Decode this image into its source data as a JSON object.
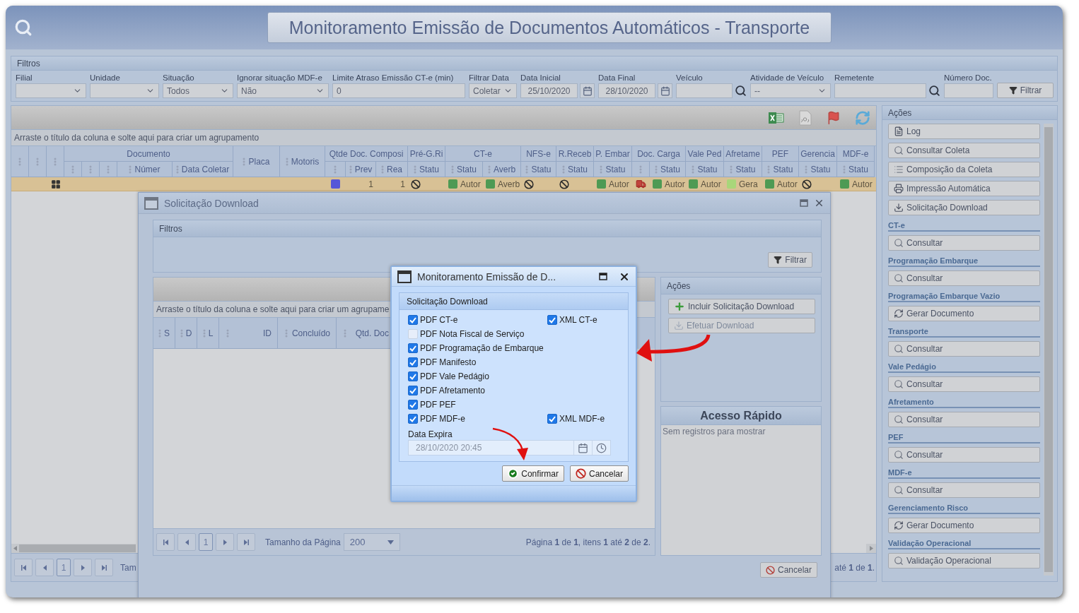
{
  "header": {
    "title": "Monitoramento Emissão de Documentos Automáticos - Transporte"
  },
  "filters": {
    "title": "Filtros",
    "fields": [
      {
        "label": "Filial",
        "kind": "select"
      },
      {
        "label": "Unidade",
        "kind": "select"
      },
      {
        "label": "Situação",
        "kind": "select",
        "value": "Todos"
      },
      {
        "label": "Ignorar situação MDF-e",
        "kind": "select",
        "value": "Não"
      },
      {
        "label": "Limite Atraso Emissão CT-e (min)",
        "kind": "text",
        "value": "0"
      },
      {
        "label": "Filtrar Data",
        "kind": "select",
        "value": "Coletar"
      },
      {
        "label": "Data Inicial",
        "kind": "date",
        "value": "25/10/2020"
      },
      {
        "label": "Data Final",
        "kind": "date",
        "value": "28/10/2020"
      },
      {
        "label": "Veículo",
        "kind": "lookup"
      },
      {
        "label": "Atividade de Veículo",
        "kind": "select",
        "value": "--"
      },
      {
        "label": "Remetente",
        "kind": "lookup"
      },
      {
        "label": "Número Doc.",
        "kind": "text"
      }
    ],
    "button": "Filtrar"
  },
  "grid": {
    "group_hint": "Arraste o título da coluna e solte aqui para criar um agrupamento",
    "columns": [
      {
        "grip": true
      },
      {
        "grip": true
      },
      {
        "grip": true
      },
      {
        "label": "Documento",
        "subcolumns": [
          {
            "grip": true
          },
          {
            "grip": true
          },
          {
            "grip": true
          },
          {
            "grip": true,
            "label": "Númer"
          },
          {
            "grip": true,
            "label": "Data Coletar"
          }
        ]
      },
      {
        "grip": true,
        "label": "Placa"
      },
      {
        "grip": true,
        "label": "Motoris"
      },
      {
        "label": "Qtde Doc. Composi",
        "subcolumns": [
          {
            "grip": true
          },
          {
            "grip": true,
            "label": "Prev"
          },
          {
            "grip": true,
            "label": "Rea"
          }
        ]
      },
      {
        "label": "Pré-G.Ri",
        "subcolumns": [
          {
            "grip": true,
            "label": "Statu"
          }
        ]
      },
      {
        "label": "CT-e",
        "subcolumns": [
          {
            "grip": true,
            "label": "Statu"
          },
          {
            "grip": true,
            "label": "Averb"
          }
        ]
      },
      {
        "label": "NFS-e",
        "subcolumns": [
          {
            "grip": true,
            "label": "Statu"
          }
        ]
      },
      {
        "label": "R.Receb",
        "subcolumns": [
          {
            "grip": true,
            "label": "Statu"
          }
        ]
      },
      {
        "label": "P. Embar",
        "subcolumns": [
          {
            "grip": true,
            "label": "Statu"
          }
        ]
      },
      {
        "label": "Doc. Carga",
        "subcolumns": [
          {
            "grip": true
          },
          {
            "grip": true,
            "label": "Statu"
          }
        ]
      },
      {
        "label": "Vale Ped",
        "subcolumns": [
          {
            "grip": true,
            "label": "Statu"
          }
        ]
      },
      {
        "label": "Afretame",
        "subcolumns": [
          {
            "grip": true,
            "label": "Statu"
          }
        ]
      },
      {
        "label": "PEF",
        "subcolumns": [
          {
            "grip": true,
            "label": "Statu"
          }
        ]
      },
      {
        "label": "Gerencia",
        "subcolumns": [
          {
            "grip": true,
            "label": "Statu"
          }
        ]
      },
      {
        "label": "MDF-e",
        "subcolumns": [
          {
            "grip": true,
            "label": "Statu"
          }
        ]
      }
    ],
    "row": {
      "cells": [
        {
          "kind": "blank"
        },
        {
          "kind": "blank"
        },
        {
          "kind": "group-icon"
        },
        {
          "kind": "blank"
        },
        {
          "kind": "blank"
        },
        {
          "kind": "blank"
        },
        {
          "kind": "blank"
        },
        {
          "kind": "blank"
        },
        {
          "kind": "blank"
        },
        {
          "kind": "blank"
        },
        {
          "kind": "swatch",
          "color": "#5656d8"
        },
        {
          "kind": "number",
          "value": "1"
        },
        {
          "kind": "number",
          "value": "1"
        },
        {
          "kind": "blocked"
        },
        {
          "kind": "status",
          "label": "Autor",
          "color": "#4e9a54"
        },
        {
          "kind": "status",
          "label": "Averb",
          "color": "#4e9a54"
        },
        {
          "kind": "blocked"
        },
        {
          "kind": "blocked"
        },
        {
          "kind": "status",
          "label": "Autor",
          "color": "#4e9a54"
        },
        {
          "kind": "truck"
        },
        {
          "kind": "status",
          "label": "Autor",
          "color": "#4e9a54"
        },
        {
          "kind": "status",
          "label": "Autor",
          "color": "#4e9a54"
        },
        {
          "kind": "status",
          "label": "Gera",
          "color": "#a8d67a"
        },
        {
          "kind": "status",
          "label": "Autor",
          "color": "#4e9a54"
        },
        {
          "kind": "blocked"
        },
        {
          "kind": "status",
          "label": "Autor",
          "color": "#4e9a54"
        }
      ]
    },
    "pager": {
      "page": "1",
      "size_label": "Tam",
      "summary": "até **1** de **1**."
    }
  },
  "actions": {
    "title": "Ações",
    "buttons": [
      {
        "label": "Log",
        "kind": "log"
      },
      {
        "label": "Consultar Coleta",
        "kind": "search"
      },
      {
        "label": "Composição da Coleta",
        "kind": "list"
      },
      {
        "label": "Impressão Automática",
        "kind": "print"
      },
      {
        "label": "Solicitação Download",
        "kind": "download"
      }
    ],
    "sections": [
      {
        "title": "CT-e",
        "buttons": [
          {
            "label": "Consultar",
            "kind": "search"
          }
        ]
      },
      {
        "title": "Programação Embarque",
        "buttons": [
          {
            "label": "Consultar",
            "kind": "search"
          }
        ]
      },
      {
        "title": "Programação Embarque Vazio",
        "buttons": [
          {
            "label": "Gerar Documento",
            "kind": "generate"
          }
        ]
      },
      {
        "title": "Transporte",
        "buttons": [
          {
            "label": "Consultar",
            "kind": "search"
          }
        ]
      },
      {
        "title": "Vale Pedágio",
        "buttons": [
          {
            "label": "Consultar",
            "kind": "search"
          }
        ]
      },
      {
        "title": "Afretamento",
        "buttons": [
          {
            "label": "Consultar",
            "kind": "search"
          }
        ]
      },
      {
        "title": "PEF",
        "buttons": [
          {
            "label": "Consultar",
            "kind": "search"
          }
        ]
      },
      {
        "title": "MDF-e",
        "buttons": [
          {
            "label": "Consultar",
            "kind": "search"
          }
        ]
      },
      {
        "title": "Gerenciamento Risco",
        "buttons": [
          {
            "label": "Gerar Documento",
            "kind": "generate"
          }
        ]
      },
      {
        "title": "Validação Operacional",
        "buttons": [
          {
            "label": "Validação Operacional",
            "kind": "search"
          }
        ]
      }
    ]
  },
  "download_window": {
    "title": "Solicitação Download",
    "filters": {
      "title": "Filtros",
      "button": "Filtrar"
    },
    "grid": {
      "group_hint": "Arraste o título da coluna e solte aqui para criar um agrupame",
      "columns": [
        {
          "grip": true,
          "label": "S"
        },
        {
          "grip": true,
          "label": "D"
        },
        {
          "grip": true,
          "label": "L"
        },
        {
          "grip": true,
          "label": "ID"
        },
        {
          "grip": true,
          "label": "Concluído"
        },
        {
          "grip": true,
          "label": "Qtd. Doc"
        }
      ],
      "pager": {
        "page": "1",
        "size_label": "Tamanho da Página",
        "size": "200",
        "summary": "Página **1** de **1**, itens **1** até **2** de **2**."
      }
    },
    "actions": {
      "title": "Ações",
      "buttons": [
        {
          "label": "Incluir Solicitação Download",
          "kind": "add",
          "disabled": false
        },
        {
          "label": "Efetuar Download",
          "kind": "download",
          "disabled": true
        }
      ]
    },
    "quick_access": {
      "title": "Acesso Rápido",
      "empty": "Sem registros para mostrar"
    },
    "cancel": "Cancelar"
  },
  "dialog": {
    "title": "Monitoramento Emissão de D...",
    "panel_title": "Solicitação Download",
    "rows": [
      [
        {
          "label": "PDF CT-e",
          "checked": true
        },
        {
          "label": "XML CT-e",
          "checked": true
        }
      ],
      [
        {
          "label": "PDF Nota Fiscal de Serviço",
          "checked": false
        }
      ],
      [
        {
          "label": "PDF Programação de Embarque",
          "checked": true
        }
      ],
      [
        {
          "label": "PDF Manifesto",
          "checked": true
        }
      ],
      [
        {
          "label": "PDF Vale Pedágio",
          "checked": true
        }
      ],
      [
        {
          "label": "PDF Afretamento",
          "checked": true
        }
      ],
      [
        {
          "label": "PDF PEF",
          "checked": true
        }
      ],
      [
        {
          "label": "PDF MDF-e",
          "checked": true
        },
        {
          "label": "XML MDF-e",
          "checked": true
        }
      ]
    ],
    "expiry": {
      "label": "Data Expira",
      "value": "28/10/2020 20:45"
    },
    "buttons": [
      {
        "label": "Confirmar",
        "kind": "confirm"
      },
      {
        "label": "Cancelar",
        "kind": "cancel"
      }
    ]
  }
}
